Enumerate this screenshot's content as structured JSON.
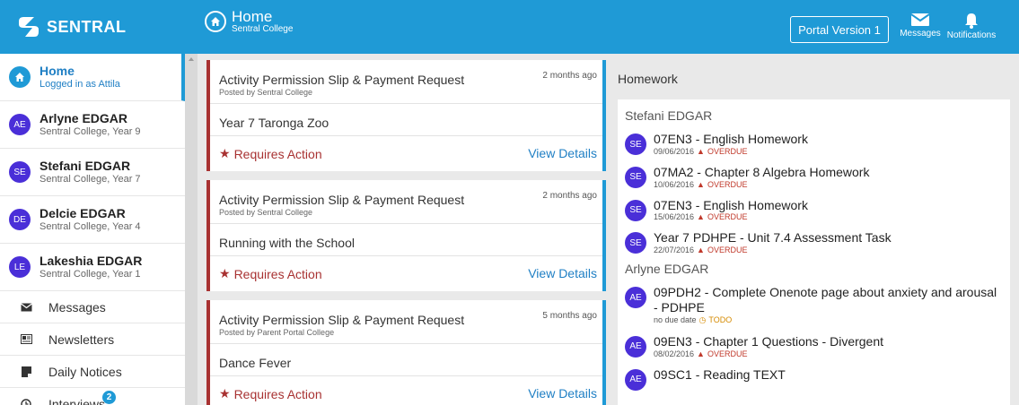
{
  "brand": {
    "name": "SENTRAL"
  },
  "header": {
    "title": "Home",
    "subtitle": "Sentral College",
    "portal_button": "Portal Version 1",
    "messages_label": "Messages",
    "notifications_label": "Notifications"
  },
  "sidebar": {
    "home": {
      "name": "Home",
      "sub": "Logged in as Attila"
    },
    "people": [
      {
        "initials": "AE",
        "name": "Arlyne EDGAR",
        "sub": "Sentral College, Year 9"
      },
      {
        "initials": "SE",
        "name": "Stefani EDGAR",
        "sub": "Sentral College, Year 7"
      },
      {
        "initials": "DE",
        "name": "Delcie EDGAR",
        "sub": "Sentral College, Year 4"
      },
      {
        "initials": "LE",
        "name": "Lakeshia EDGAR",
        "sub": "Sentral College, Year 1"
      }
    ],
    "links": [
      {
        "label": "Messages",
        "icon": "envelope-icon"
      },
      {
        "label": "Newsletters",
        "icon": "newspaper-icon"
      },
      {
        "label": "Daily Notices",
        "icon": "notice-icon"
      },
      {
        "label": "Interviews",
        "icon": "clock-icon",
        "badge": "2"
      }
    ]
  },
  "cards": [
    {
      "title": "Activity Permission Slip & Payment Request",
      "posted": "Posted by Sentral College",
      "time": "2 months ago",
      "event": "Year 7 Taronga Zoo",
      "action": "Requires Action",
      "details": "View Details"
    },
    {
      "title": "Activity Permission Slip & Payment Request",
      "posted": "Posted by Sentral College",
      "time": "2 months ago",
      "event": "Running with the School",
      "action": "Requires Action",
      "details": "View Details"
    },
    {
      "title": "Activity Permission Slip & Payment Request",
      "posted": "Posted by Parent Portal College",
      "time": "5 months ago",
      "event": "Dance Fever",
      "action": "Requires Action",
      "details": "View Details"
    }
  ],
  "homework": {
    "title": "Homework",
    "groups": [
      {
        "student": "Stefani EDGAR",
        "items": [
          {
            "initials": "SE",
            "name": "07EN3 - English Homework",
            "date": "09/06/2016",
            "status": "OVERDUE"
          },
          {
            "initials": "SE",
            "name": "07MA2 - Chapter 8 Algebra Homework",
            "date": "10/06/2016",
            "status": "OVERDUE"
          },
          {
            "initials": "SE",
            "name": "07EN3 - English Homework",
            "date": "15/06/2016",
            "status": "OVERDUE"
          },
          {
            "initials": "SE",
            "name": "Year 7 PDHPE - Unit 7.4 Assessment Task",
            "date": "22/07/2016",
            "status": "OVERDUE"
          }
        ]
      },
      {
        "student": "Arlyne EDGAR",
        "items": [
          {
            "initials": "AE",
            "name": "09PDH2 - Complete Onenote page about anxiety and arousal - PDHPE",
            "date": "no due date",
            "status": "TODO"
          },
          {
            "initials": "AE",
            "name": "09EN3 - Chapter 1 Questions - Divergent",
            "date": "08/02/2016",
            "status": "OVERDUE"
          },
          {
            "initials": "AE",
            "name": "09SC1 - Reading TEXT",
            "date": "",
            "status": ""
          }
        ]
      }
    ]
  },
  "colors": {
    "header": "#1f9ad6",
    "accent_red": "#a83232",
    "link": "#1f7fc4",
    "avatar": "#4a2fd8"
  }
}
